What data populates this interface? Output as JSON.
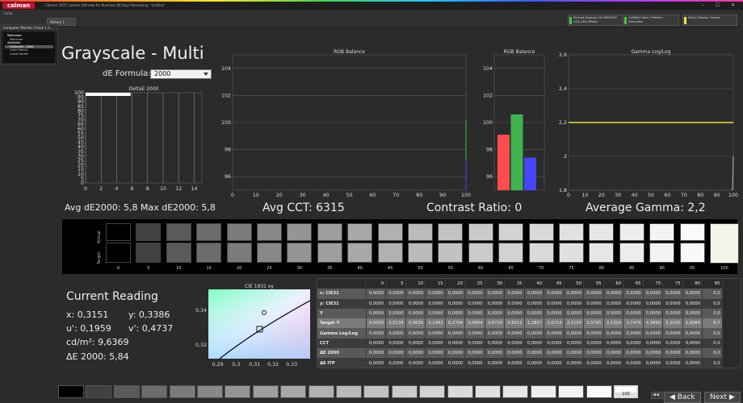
{
  "window": {
    "app_logo": "calman",
    "title": "Calman 2025 Calman Ultimate for Business 86 Days Remaining - Untitled",
    "controls": "–  ☐  ✕"
  },
  "toolbar": {
    "history_tab": "History 1",
    "small_label": "Comp"
  },
  "devices": [
    {
      "line1": "Portrait Displays C6-HDR5000",
      "line2": "LCD (LED White)",
      "color": "#3bd13b"
    },
    {
      "line1": "CalMAN Client 3 Pattern Generator",
      "line2": "",
      "color": "#3bd13b"
    },
    {
      "line1": "Direct Display Control",
      "line2": "",
      "color": "#e8e83b"
    }
  ],
  "sidebar": {
    "title": "Computer Monitor Check 1.1...",
    "items": [
      {
        "label": "Welcome",
        "level": 1,
        "bold": true,
        "selected": false
      },
      {
        "label": "Welcome",
        "level": 2,
        "bold": false,
        "selected": false
      },
      {
        "label": "Analysis",
        "level": 1,
        "bold": true,
        "selected": false
      },
      {
        "label": "Grayscale - Multi",
        "level": 2,
        "bold": false,
        "selected": true
      },
      {
        "label": "Color Gamut",
        "level": 2,
        "bold": false,
        "selected": false
      },
      {
        "label": "ColorChecker",
        "level": 2,
        "bold": false,
        "selected": false
      }
    ]
  },
  "main": {
    "title": "Grayscale - Multi",
    "de_formula_label": "dE Formula:",
    "de_formula_value": "2000",
    "avg_de": "Avg dE2000: 5,8 Max dE2000: 5,8",
    "avg_cct": "Avg CCT: 6315",
    "contrast": "Contrast Ratio: 0",
    "avg_gamma": "Average Gamma: 2,2"
  },
  "chart_data": [
    {
      "type": "bar",
      "title": "DeltaE 2000",
      "y_ticks": [
        "100",
        "95",
        "90",
        "85",
        "80",
        "75",
        "70",
        "65",
        "60",
        "55",
        "50",
        "45",
        "40",
        "35",
        "30",
        "25",
        "20",
        "15",
        "10",
        "5",
        "0"
      ],
      "x_ticks": [
        "0",
        "2",
        "4",
        "6",
        "8",
        "10",
        "12",
        "14"
      ],
      "xlim": [
        0,
        15
      ],
      "categories": [
        "100"
      ],
      "values": [
        5.8
      ]
    },
    {
      "type": "line",
      "title": "RGB Balance",
      "y_ticks": [
        "104",
        "102",
        "100",
        "98",
        "96"
      ],
      "x_ticks": [
        "0",
        "10",
        "20",
        "30",
        "40",
        "50",
        "60",
        "70",
        "80",
        "90",
        "100"
      ],
      "ylim": [
        95,
        105
      ],
      "xlim": [
        0,
        100
      ]
    },
    {
      "type": "bar",
      "title": "RGB Balance",
      "y_ticks": [
        "104",
        "102",
        "100",
        "98",
        "96"
      ],
      "ylim": [
        95,
        105
      ],
      "categories": [
        "R",
        "G",
        "B"
      ],
      "values": [
        99.1,
        100.6,
        97.4
      ],
      "colors": [
        "#ff4d4d",
        "#3fb34f",
        "#4646ff"
      ]
    },
    {
      "type": "line",
      "title": "Gamma Log/Log",
      "y_ticks": [
        "2,6",
        "2,4",
        "2,2",
        "2",
        "1,8"
      ],
      "x_ticks": [
        "0",
        "10",
        "20",
        "30",
        "40",
        "50",
        "60",
        "70",
        "80",
        "90",
        "100"
      ],
      "ylim": [
        1.8,
        2.6
      ],
      "xlim": [
        0,
        100
      ],
      "series": [
        {
          "name": "",
          "values": [
            2.2,
            2.2
          ],
          "color": "#e8e830"
        }
      ]
    },
    {
      "type": "scatter",
      "title": "CIE 1931 xy",
      "x_ticks": [
        "0,29",
        "0,3",
        "0,31",
        "0,32",
        "0,33"
      ],
      "y_ticks": [
        "0,34",
        "0,32"
      ],
      "xlim": [
        0.285,
        0.34
      ],
      "ylim": [
        0.312,
        0.352
      ],
      "target": {
        "x": 0.3127,
        "y": 0.329
      },
      "measured": {
        "x": 0.3151,
        "y": 0.3386
      }
    }
  ],
  "swatches": {
    "axis_actual": "Actual",
    "axis_target": "Target",
    "levels": [
      "0",
      "5",
      "10",
      "15",
      "20",
      "25",
      "30",
      "35",
      "40",
      "45",
      "50",
      "55",
      "60",
      "65",
      "70",
      "75",
      "80",
      "85",
      "90",
      "95",
      "100"
    ]
  },
  "reading": {
    "title": "Current Reading",
    "x": "x: 0,3151",
    "y": "y: 0,3386",
    "u": "u': 0,1959",
    "v": "v': 0,4737",
    "cd": "cd/m²: 9,6369",
    "de": "ΔE 2000: 5,84"
  },
  "table": {
    "columns": [
      "",
      "0",
      "5",
      "10",
      "15",
      "20",
      "25",
      "30",
      "35",
      "40",
      "45",
      "50",
      "55",
      "60",
      "65",
      "70",
      "75",
      "80",
      "85"
    ],
    "rows": [
      {
        "label": "x: CIE31",
        "cells": [
          "0,0000",
          "0,0000",
          "0,0000",
          "0,0000",
          "0,0000",
          "0,0000",
          "0,0000",
          "0,0000",
          "0,0000",
          "0,0000",
          "0,0000",
          "0,0000",
          "0,0000",
          "0,0000",
          "0,0000",
          "0,0000",
          "0,0000",
          "0,0"
        ]
      },
      {
        "label": "y: CIE31",
        "cells": [
          "0,0000",
          "0,0000",
          "0,0000",
          "0,0000",
          "0,0000",
          "0,0000",
          "0,0000",
          "0,0000",
          "0,0000",
          "0,0000",
          "0,0000",
          "0,0000",
          "0,0000",
          "0,0000",
          "0,0000",
          "0,0000",
          "0,0000",
          "0,0"
        ]
      },
      {
        "label": "Y",
        "cells": [
          "0,0000",
          "0,0000",
          "0,0000",
          "0,0000",
          "0,0000",
          "0,0000",
          "0,0000",
          "0,0000",
          "0,0000",
          "0,0000",
          "0,0000",
          "0,0000",
          "0,0000",
          "0,0000",
          "0,0000",
          "0,0000",
          "0,0000",
          "0,0"
        ]
      },
      {
        "label": "Target Y",
        "cells": [
          "0,0000",
          "0,0138",
          "0,0635",
          "0,1462",
          "0,2794",
          "0,4604",
          "0,6720",
          "0,9511",
          "1,2837",
          "1,6714",
          "2,1155",
          "2,5765",
          "3,1324",
          "3,7479",
          "4,3699",
          "5,1030",
          "5,8984",
          "6,7"
        ]
      },
      {
        "label": "Gamma Log/Log",
        "cells": [
          "0,0000",
          "0,0000",
          "0,0000",
          "0,0000",
          "0,0000",
          "0,0000",
          "0,0000",
          "0,0000",
          "0,0000",
          "0,0000",
          "0,0000",
          "0,0000",
          "0,0000",
          "0,0000",
          "0,0000",
          "0,0000",
          "0,0000",
          "0,0"
        ]
      },
      {
        "label": "CCT",
        "cells": [
          "0,0000",
          "0,0000",
          "0,0000",
          "0,0000",
          "0,0000",
          "0,0000",
          "0,0000",
          "0,0000",
          "0,0000",
          "0,0000",
          "0,0000",
          "0,0000",
          "0,0000",
          "0,0000",
          "0,0000",
          "0,0000",
          "0,0000",
          "0,0"
        ]
      },
      {
        "label": "ΔE 2000",
        "cells": [
          "0,0000",
          "0,0000",
          "0,0000",
          "0,0000",
          "0,0000",
          "0,0000",
          "0,0000",
          "0,0000",
          "0,0000",
          "0,0000",
          "0,0000",
          "0,0000",
          "0,0000",
          "0,0000",
          "0,0000",
          "0,0000",
          "0,0000",
          "0,0"
        ]
      },
      {
        "label": "ΔE ITP",
        "cells": [
          "0,0000",
          "0,0000",
          "0,0000",
          "0,0000",
          "0,0000",
          "0,0000",
          "0,0000",
          "0,0000",
          "0,0000",
          "0,0000",
          "0,0000",
          "0,0000",
          "0,0000",
          "0,0000",
          "0,0000",
          "0,0000",
          "0,0000",
          "0,0"
        ]
      }
    ]
  },
  "bottom": {
    "selected_label": "100",
    "back_label": "Back",
    "next_label": "Next",
    "back_icon": "chevron-left-icon",
    "next_icon": "chevron-right-icon"
  }
}
